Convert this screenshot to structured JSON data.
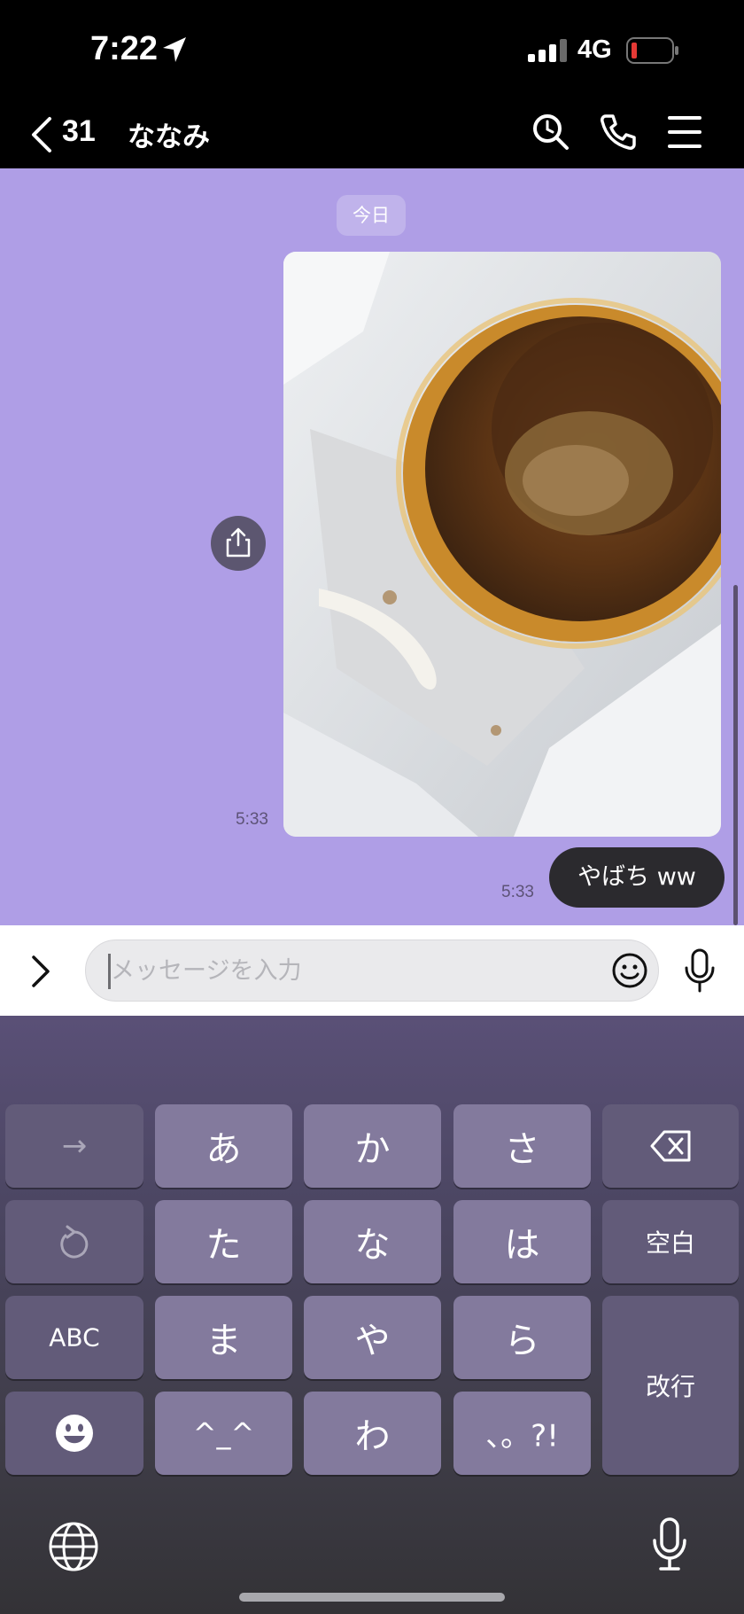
{
  "status_bar": {
    "time": "7:22",
    "network": "4G",
    "battery_color": "#e53935"
  },
  "header": {
    "unread_count": "31",
    "chat_name": "ななみ"
  },
  "chat": {
    "date_label": "今日",
    "photo_time": "5:33",
    "text_message": "やばち ww",
    "text_time": "5:33",
    "background": "#af9ee6"
  },
  "input": {
    "placeholder": "メッセージを入力"
  },
  "keyboard": {
    "row1": [
      "→",
      "あ",
      "か",
      "さ",
      "delete"
    ],
    "row2": [
      "undo",
      "た",
      "な",
      "は",
      "空白"
    ],
    "row3": [
      "ABC",
      "ま",
      "や",
      "ら"
    ],
    "row4": [
      "emoji",
      "^_^",
      "わ",
      "、。?!"
    ],
    "return_label": "改行"
  }
}
